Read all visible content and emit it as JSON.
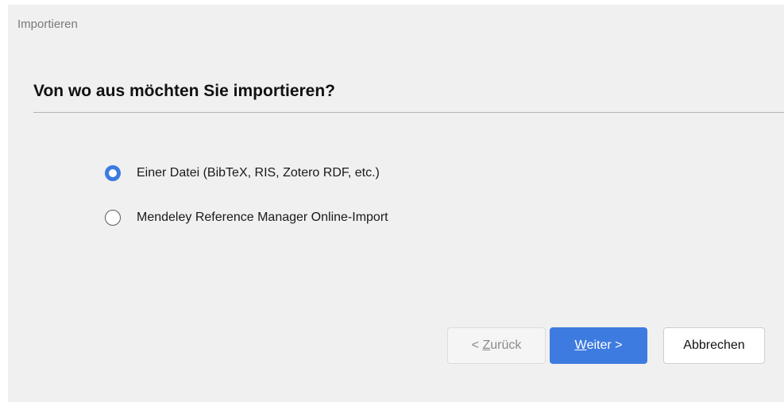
{
  "window": {
    "title": "Importieren"
  },
  "main": {
    "heading": "Von wo aus möchten Sie importieren?",
    "options": [
      {
        "label": "Einer Datei (BibTeX, RIS, Zotero RDF, etc.)",
        "checked": true
      },
      {
        "label": "Mendeley Reference Manager Online-Import",
        "checked": false
      }
    ]
  },
  "buttons": {
    "back": {
      "prefix": "< ",
      "accesskey": "Z",
      "rest": "urück"
    },
    "next": {
      "accesskey": "W",
      "rest": "eiter >"
    },
    "cancel": "Abbrechen"
  },
  "colors": {
    "accent": "#3d7be0",
    "background": "#f0f0f0"
  }
}
